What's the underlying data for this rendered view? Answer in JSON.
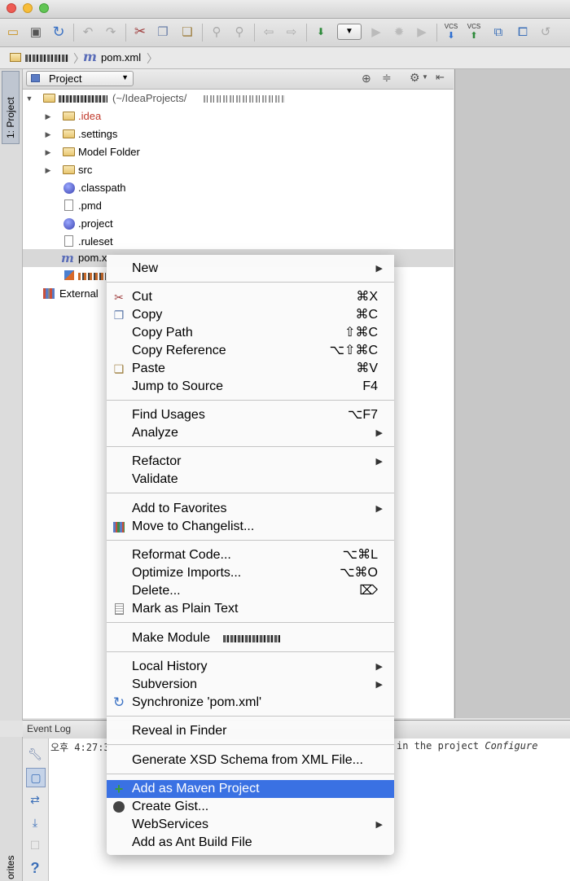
{
  "toolbar": {
    "icons": [
      "open-folder-icon",
      "save-icon",
      "sync-icon",
      "undo-icon",
      "redo-icon",
      "cut-icon",
      "copy-icon",
      "paste-icon",
      "find-icon",
      "replace-icon",
      "back-icon",
      "forward-icon",
      "make-project-icon",
      "run-config-dropdown",
      "run-icon",
      "debug-icon",
      "coverage-icon",
      "vcs-update-icon",
      "vcs-commit-icon",
      "vcs-history-icon",
      "vcs-compare-icon",
      "vcs-revert-icon"
    ],
    "vcs_label": "VCS"
  },
  "breadcrumb": {
    "file": "pom.xml"
  },
  "left_stripe": {
    "project_tab": "1: Project",
    "favorites_tab": "orites"
  },
  "project_panel": {
    "title": "Project",
    "root_path": "(~/IdeaProjects/",
    "tree": [
      {
        "label": ".idea",
        "type": "folder",
        "color": "#c0392b"
      },
      {
        "label": ".settings",
        "type": "folder"
      },
      {
        "label": "Model Folder",
        "type": "folder"
      },
      {
        "label": "src",
        "type": "folder"
      },
      {
        "label": ".classpath",
        "type": "eclipse"
      },
      {
        "label": ".pmd",
        "type": "file"
      },
      {
        "label": ".project",
        "type": "eclipse"
      },
      {
        "label": ".ruleset",
        "type": "file"
      },
      {
        "label": "pom.x",
        "type": "maven"
      }
    ],
    "external": "External"
  },
  "event_log": {
    "title": "Event Log",
    "time": "오후 4:27:3",
    "message_tail": "in the project",
    "configure": "Configure"
  },
  "menu": {
    "new": "New",
    "cut": "Cut",
    "cut_sc": "⌘X",
    "copy": "Copy",
    "copy_sc": "⌘C",
    "copy_path": "Copy Path",
    "copy_path_sc": "⇧⌘C",
    "copy_reference": "Copy Reference",
    "copy_reference_sc": "⌥⇧⌘C",
    "paste": "Paste",
    "paste_sc": "⌘V",
    "jump_to_source": "Jump to Source",
    "jump_to_source_sc": "F4",
    "find_usages": "Find Usages",
    "find_usages_sc": "⌥F7",
    "analyze": "Analyze",
    "refactor": "Refactor",
    "validate": "Validate",
    "add_to_favorites": "Add to Favorites",
    "move_to_changelist": "Move to Changelist...",
    "reformat_code": "Reformat Code...",
    "reformat_code_sc": "⌥⌘L",
    "optimize_imports": "Optimize Imports...",
    "optimize_imports_sc": "⌥⌘O",
    "delete": "Delete...",
    "delete_sc": "⌦",
    "mark_as_plain_text": "Mark as Plain Text",
    "make_module": "Make Module",
    "local_history": "Local History",
    "subversion": "Subversion",
    "synchronize": "Synchronize 'pom.xml'",
    "reveal_in_finder": "Reveal in Finder",
    "generate_xsd": "Generate XSD Schema from XML File...",
    "add_as_maven": "Add as Maven Project",
    "create_gist": "Create Gist...",
    "webservices": "WebServices",
    "add_as_ant": "Add as Ant Build File"
  }
}
